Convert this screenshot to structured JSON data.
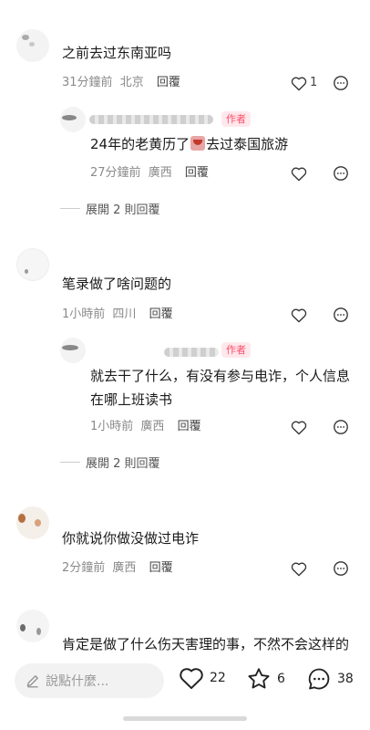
{
  "comments": [
    {
      "text": "之前去过东南亚吗",
      "time": "31分鐘前",
      "location": "北京",
      "reply_label": "回覆",
      "likes": "1",
      "reply": {
        "badge": "作者",
        "text_before": "24年的老黄历了",
        "text_after": "去过泰国旅游",
        "time": "27分鐘前",
        "location": "廣西",
        "reply_label": "回覆"
      },
      "expand": "展開 2 則回覆"
    },
    {
      "text": "笔录做了啥问题的",
      "time": "1小時前",
      "location": "四川",
      "reply_label": "回覆",
      "reply": {
        "badge": "作者",
        "text": "就去干了什么，有没有参与电诈，个人信息在哪上班读书",
        "time": "1小時前",
        "location": "廣西",
        "reply_label": "回覆"
      },
      "expand": "展開 2 則回覆"
    },
    {
      "text": "你就说你做没做过电诈",
      "time": "2分鐘前",
      "location": "廣西",
      "reply_label": "回覆"
    },
    {
      "text": "肯定是做了什么伤天害理的事，不然不会这样的"
    }
  ],
  "bottom_bar": {
    "input_placeholder": "說點什麼...",
    "likes": "22",
    "favorites": "6",
    "comments": "38"
  },
  "icons": {
    "like": "heart-icon",
    "more": "ellipsis-icon",
    "favorite": "star-icon",
    "comment": "chat-bubble-icon",
    "edit": "pencil-icon"
  },
  "colors": {
    "author_badge": "#ff4d6a",
    "meta_text": "#8a8a8a"
  }
}
